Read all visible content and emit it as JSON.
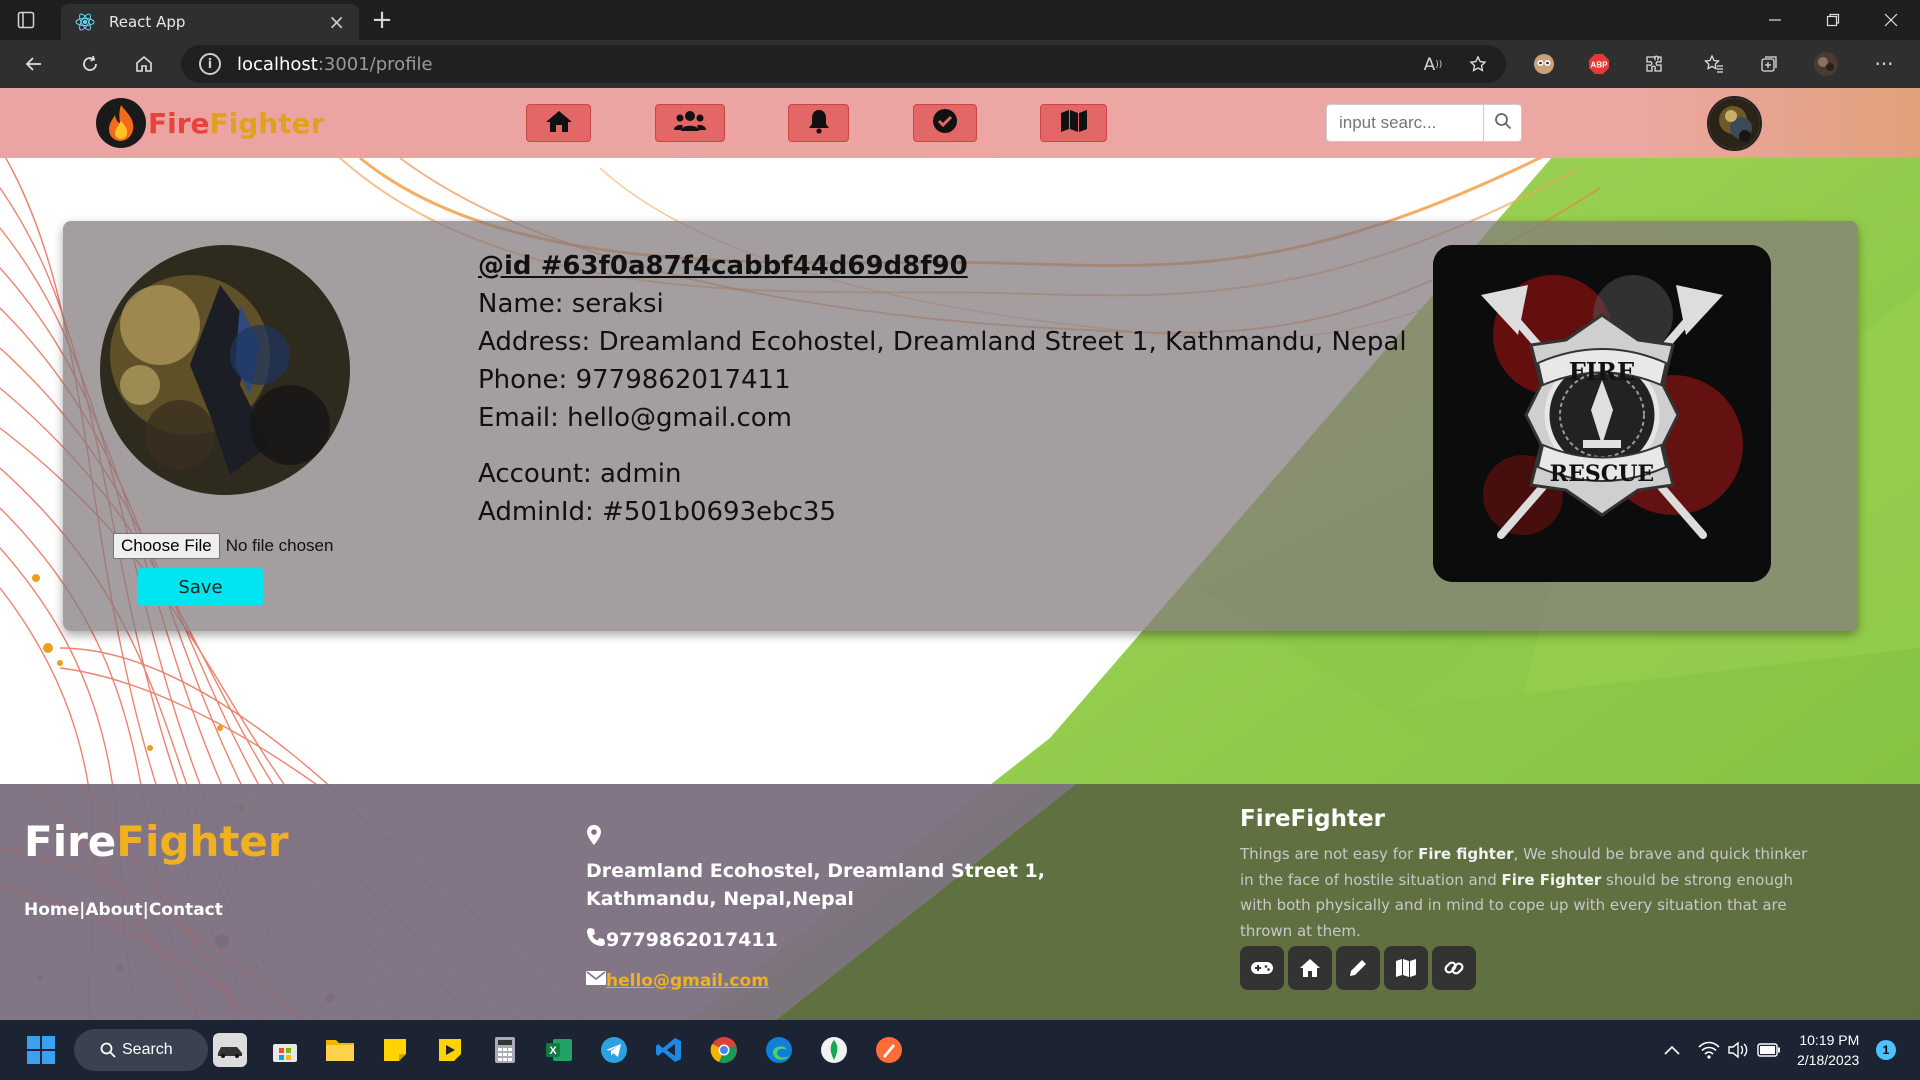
{
  "browser": {
    "tab_title": "React App",
    "url_host": "localhost",
    "url_path": ":3001/profile"
  },
  "navbar": {
    "brand_part1": "Fire",
    "brand_part2": "Fighter",
    "nav_icons": [
      "home-icon",
      "users-icon",
      "bell-icon",
      "check-circle-icon",
      "map-icon"
    ],
    "search_placeholder": "input searc..."
  },
  "profile": {
    "id_line": "@id #63f0a87f4cabbf44d69d8f90",
    "name_line": "Name: seraksi",
    "address_line": "Address: Dreamland Ecohostel, Dreamland Street 1, Kathmandu, Nepal",
    "phone_line": "Phone: 9779862017411",
    "email_line": "Email: hello@gmail.com",
    "account_line": "Account: admin",
    "adminid_line": "AdminId: #501b0693ebc35",
    "choose_file_label": "Choose File",
    "no_file_text": "No file chosen",
    "save_label": "Save"
  },
  "badge": {
    "top_text": "FIRE",
    "bottom_text": "RESCUE"
  },
  "footer": {
    "brand_part1": "Fire",
    "brand_part2": "Fighter",
    "link_home": "Home",
    "link_about": "About",
    "link_contact": "Contact",
    "separator": "|",
    "address": "Dreamland Ecohostel, Dreamland Street 1, Kathmandu, Nepal,Nepal",
    "phone": "9779862017411",
    "email": "hello@gmail.com",
    "about_title": "FireFighter",
    "about_seg1": "Things are not easy for ",
    "about_bold1": "Fire fighter",
    "about_seg2": ", We should be brave and quick thinker in the face of hostile situation and ",
    "about_bold2": "Fire Fighter",
    "about_seg3": " should be strong enough with both physically and in mind to cope up with every situation that are thrown at them.",
    "social_icons": [
      "gamepad-icon",
      "home-icon",
      "pencil-icon",
      "map-icon",
      "link-icon"
    ]
  },
  "taskbar": {
    "search_label": "Search",
    "time": "10:19 PM",
    "date": "2/18/2023",
    "notification_count": "1"
  },
  "colors": {
    "navbar_bg": "#eca3a3",
    "nav_button": "#e36767",
    "card_bg": "#9a9193",
    "save_button": "#00e5f0",
    "brand_red": "#e8423a",
    "brand_gold": "#e0a020",
    "footer_left": "#7b6f80",
    "footer_right": "#5e6b40",
    "green_bg": "#8dcf4a"
  }
}
